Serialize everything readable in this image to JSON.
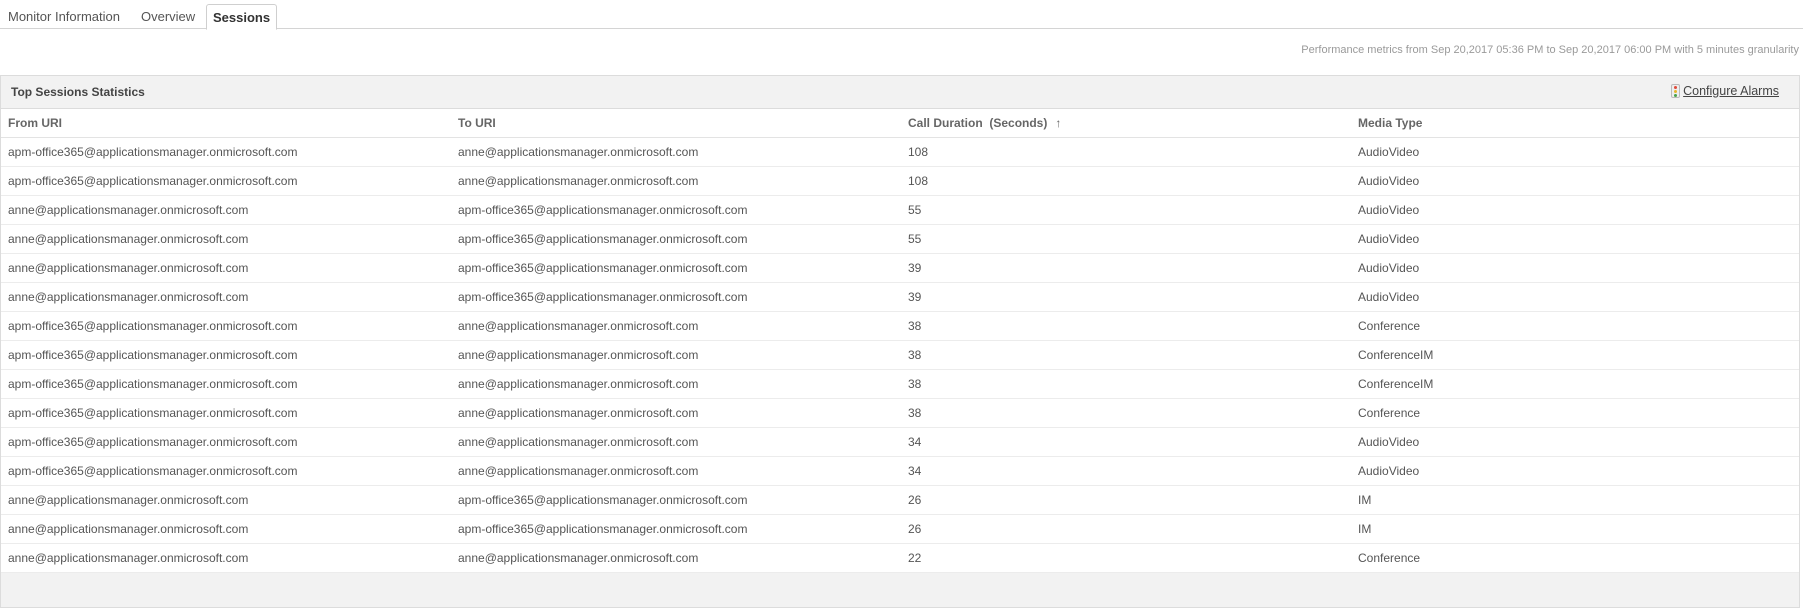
{
  "tabs": [
    {
      "label": "Monitor Information",
      "active": false
    },
    {
      "label": "Overview",
      "active": false
    },
    {
      "label": "Sessions",
      "active": true
    }
  ],
  "metrics_caption": "Performance metrics from Sep 20,2017 05:36 PM to Sep 20,2017 06:00 PM with 5 minutes granularity",
  "panel": {
    "title": "Top Sessions Statistics",
    "configure_label": "Configure Alarms",
    "configure_icon": "traffic-light-icon"
  },
  "table": {
    "columns": [
      "From URI",
      "To URI",
      "Call Duration  (Seconds)",
      "Media Type"
    ],
    "sort_icon": "↑",
    "rows": [
      [
        "apm-office365@applicationsmanager.onmicrosoft.com",
        "anne@applicationsmanager.onmicrosoft.com",
        "108",
        "AudioVideo"
      ],
      [
        "apm-office365@applicationsmanager.onmicrosoft.com",
        "anne@applicationsmanager.onmicrosoft.com",
        "108",
        "AudioVideo"
      ],
      [
        "anne@applicationsmanager.onmicrosoft.com",
        "apm-office365@applicationsmanager.onmicrosoft.com",
        "55",
        "AudioVideo"
      ],
      [
        "anne@applicationsmanager.onmicrosoft.com",
        "apm-office365@applicationsmanager.onmicrosoft.com",
        "55",
        "AudioVideo"
      ],
      [
        "anne@applicationsmanager.onmicrosoft.com",
        "apm-office365@applicationsmanager.onmicrosoft.com",
        "39",
        "AudioVideo"
      ],
      [
        "anne@applicationsmanager.onmicrosoft.com",
        "apm-office365@applicationsmanager.onmicrosoft.com",
        "39",
        "AudioVideo"
      ],
      [
        "apm-office365@applicationsmanager.onmicrosoft.com",
        "anne@applicationsmanager.onmicrosoft.com",
        "38",
        "Conference"
      ],
      [
        "apm-office365@applicationsmanager.onmicrosoft.com",
        "anne@applicationsmanager.onmicrosoft.com",
        "38",
        "ConferenceIM"
      ],
      [
        "apm-office365@applicationsmanager.onmicrosoft.com",
        "anne@applicationsmanager.onmicrosoft.com",
        "38",
        "ConferenceIM"
      ],
      [
        "apm-office365@applicationsmanager.onmicrosoft.com",
        "anne@applicationsmanager.onmicrosoft.com",
        "38",
        "Conference"
      ],
      [
        "apm-office365@applicationsmanager.onmicrosoft.com",
        "anne@applicationsmanager.onmicrosoft.com",
        "34",
        "AudioVideo"
      ],
      [
        "apm-office365@applicationsmanager.onmicrosoft.com",
        "anne@applicationsmanager.onmicrosoft.com",
        "34",
        "AudioVideo"
      ],
      [
        "anne@applicationsmanager.onmicrosoft.com",
        "apm-office365@applicationsmanager.onmicrosoft.com",
        "26",
        "IM"
      ],
      [
        "anne@applicationsmanager.onmicrosoft.com",
        "apm-office365@applicationsmanager.onmicrosoft.com",
        "26",
        "IM"
      ],
      [
        "anne@applicationsmanager.onmicrosoft.com",
        "anne@applicationsmanager.onmicrosoft.com",
        "22",
        "Conference"
      ]
    ]
  },
  "colors": {
    "panel_bg": "#f2f2f2",
    "border": "#dcdcdc",
    "text": "#555555",
    "muted": "#9a9a9a"
  }
}
